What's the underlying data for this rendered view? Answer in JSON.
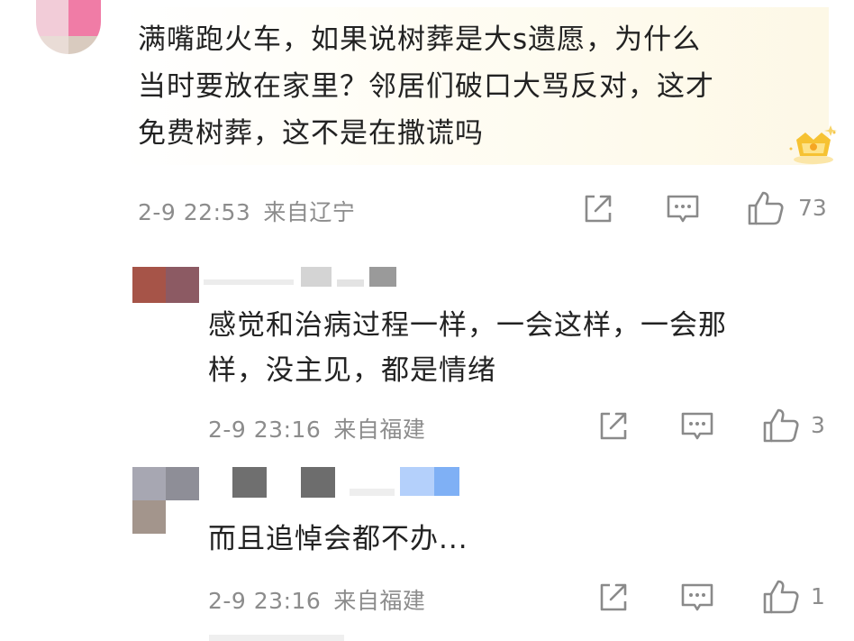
{
  "comments": [
    {
      "text_line1": "满嘴跑火车，如果说树葬是大s遗愿，为什么",
      "text_line2": "当时要放在家里？邻居们破口大骂反对，这才",
      "text_line3": "免费树葬，这不是在撒谎吗",
      "time": "2-9 22:53",
      "location": "来自辽宁",
      "likes": "73"
    },
    {
      "text_line1": "感觉和治病过程一样，一会这样，一会那",
      "text_line2": "样，没主见，都是情绪",
      "time": "2-9 23:16",
      "location": "来自福建",
      "likes": "3"
    },
    {
      "text_line1": "而且追悼会都不办...",
      "time": "2-9 23:16",
      "location": "来自福建",
      "likes": "1"
    }
  ],
  "icons": {
    "share": "share-icon",
    "reply": "comment-icon",
    "like": "thumbs-up-icon",
    "badge": "crown-badge-icon"
  },
  "colors": {
    "text": "#222222",
    "meta": "#8c8c8c",
    "bubble": "#fdf8e6",
    "icon": "#8a8a8a"
  }
}
